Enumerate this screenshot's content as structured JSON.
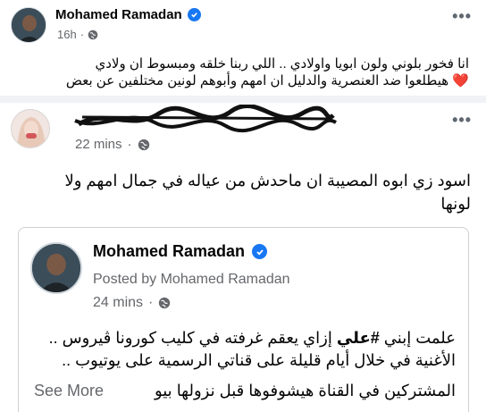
{
  "post": {
    "author": "Mohamed Ramadan",
    "time": "16h",
    "separator": "·",
    "text_line1": "انا فخور بلوني ولون ابويا واولادي .. اللي ربنا خلقه ومبسوط ان ولادي",
    "text_line2": "هيطلعوا ضد العنصرية والدليل ان امهم وأبوهم لونين مختلفين عن بعض",
    "heart": "❤️"
  },
  "share": {
    "time": "22 mins",
    "separator": "·",
    "text_line1": "اسود زي ابوه المصيبة ان ماحدش من عياله في جمال امهم ولا",
    "text_line2": "لونها"
  },
  "embed": {
    "author": "Mohamed Ramadan",
    "posted_by": "Posted by Mohamed Ramadan",
    "time": "24 mins",
    "separator": "·",
    "line1_before": "علمت إبني ",
    "hashtag": "#علي",
    "line1_after": " إزاي يعقم غرفته في كليب كورونا ڤيروس ..",
    "line2": "الأغنية في خلال أيام قليلة على قناتي الرسمية على يوتيوب ..",
    "line3": "المشتركين في القناة هيشوفوها قبل نزولها بيو ...",
    "see_more": "See More"
  },
  "icons": {
    "more": "•••",
    "verified": "verified-badge",
    "privacy": "globe-icon"
  },
  "colors": {
    "verified": "#1877f2",
    "meta": "#65676b",
    "heart": "#e41e3f"
  }
}
